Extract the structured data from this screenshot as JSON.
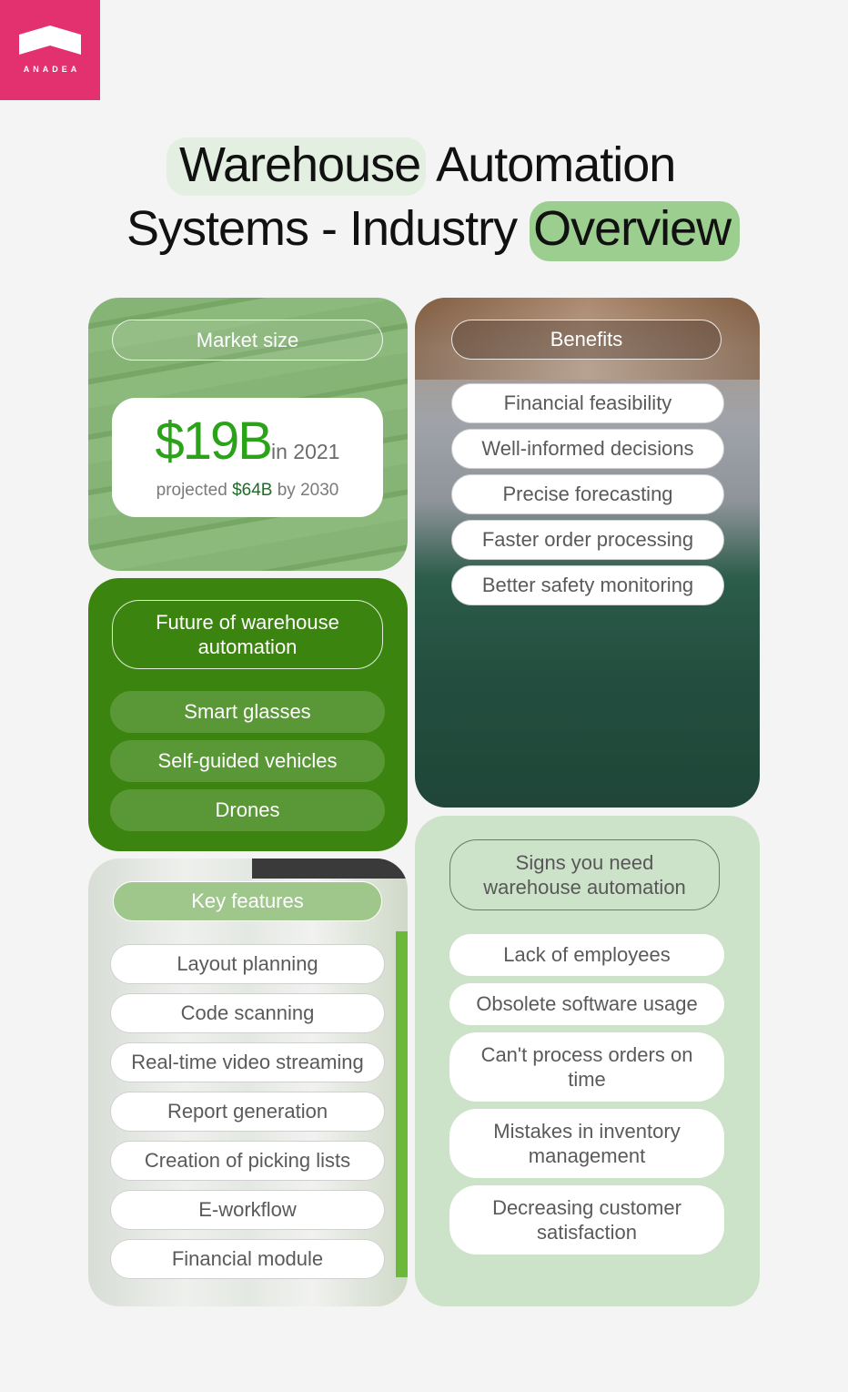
{
  "brand": {
    "name": "ANADEA",
    "color": "#e3306f"
  },
  "title": {
    "line1_highlight": "Warehouse",
    "line1_rest": "Automation",
    "line2_rest": "Systems - Industry",
    "line2_highlight": "Overview"
  },
  "market": {
    "header": "Market size",
    "value": "$19B",
    "value_suffix": "in 2021",
    "proj_prefix": "projected",
    "proj_value": "$64B",
    "proj_suffix": "by 2030"
  },
  "benefits": {
    "header": "Benefits",
    "items": [
      "Financial feasibility",
      "Well-informed decisions",
      "Precise forecasting",
      "Faster order processing",
      "Better safety monitoring"
    ]
  },
  "future": {
    "header": "Future of warehouse automation",
    "items": [
      "Smart glasses",
      "Self-guided vehicles",
      "Drones"
    ]
  },
  "features": {
    "header": "Key features",
    "items": [
      "Layout planning",
      "Code scanning",
      "Real-time video streaming",
      "Report generation",
      "Creation of picking lists",
      "E-workflow",
      "Financial module"
    ]
  },
  "signs": {
    "header": "Signs you need warehouse automation",
    "items": [
      "Lack of employees",
      "Obsolete software usage",
      "Can't process orders on time",
      "Mistakes in inventory management",
      "Decreasing customer satisfaction"
    ]
  },
  "colors": {
    "green_dark": "#3b8410",
    "green_mid": "#7fad6c",
    "green_light": "#cde3c9",
    "value_green": "#2aa318"
  }
}
